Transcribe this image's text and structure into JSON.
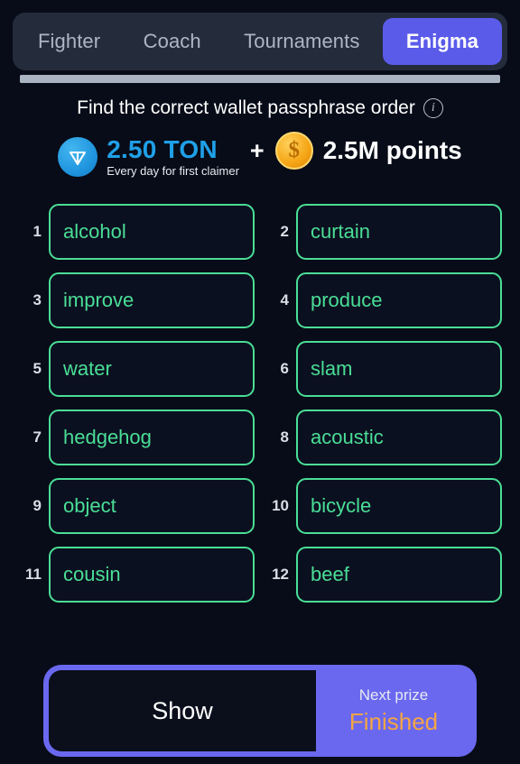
{
  "tabs": [
    {
      "label": "Fighter",
      "active": false
    },
    {
      "label": "Coach",
      "active": false
    },
    {
      "label": "Tournaments",
      "active": false
    },
    {
      "label": "Enigma",
      "active": true
    }
  ],
  "header": {
    "title": "Find the correct wallet passphrase order",
    "info_icon": "info-circle-icon"
  },
  "prize": {
    "ton_icon": "ton-coin-icon",
    "ton_amount": "2.50 TON",
    "ton_subtitle": "Every day for first claimer",
    "plus": "+",
    "points_icon": "dollar-coin-icon",
    "points_amount": "2.5M points"
  },
  "words": [
    {
      "number": "1",
      "word": "alcohol"
    },
    {
      "number": "2",
      "word": "curtain"
    },
    {
      "number": "3",
      "word": "improve"
    },
    {
      "number": "4",
      "word": "produce"
    },
    {
      "number": "5",
      "word": "water"
    },
    {
      "number": "6",
      "word": "slam"
    },
    {
      "number": "7",
      "word": "hedgehog"
    },
    {
      "number": "8",
      "word": "acoustic"
    },
    {
      "number": "9",
      "word": "object"
    },
    {
      "number": "10",
      "word": "bicycle"
    },
    {
      "number": "11",
      "word": "cousin"
    },
    {
      "number": "12",
      "word": "beef"
    }
  ],
  "bottom": {
    "show_label": "Show",
    "next_prize_label": "Next prize",
    "next_prize_value": "Finished"
  },
  "colors": {
    "background": "#080c18",
    "tabbar": "#242c3c",
    "accent_purple": "#5b5bea",
    "accent_green": "#4ade96",
    "ton_blue": "#1fa0e8",
    "coin_gold": "#f5a515",
    "finished_orange": "#f5a544"
  }
}
